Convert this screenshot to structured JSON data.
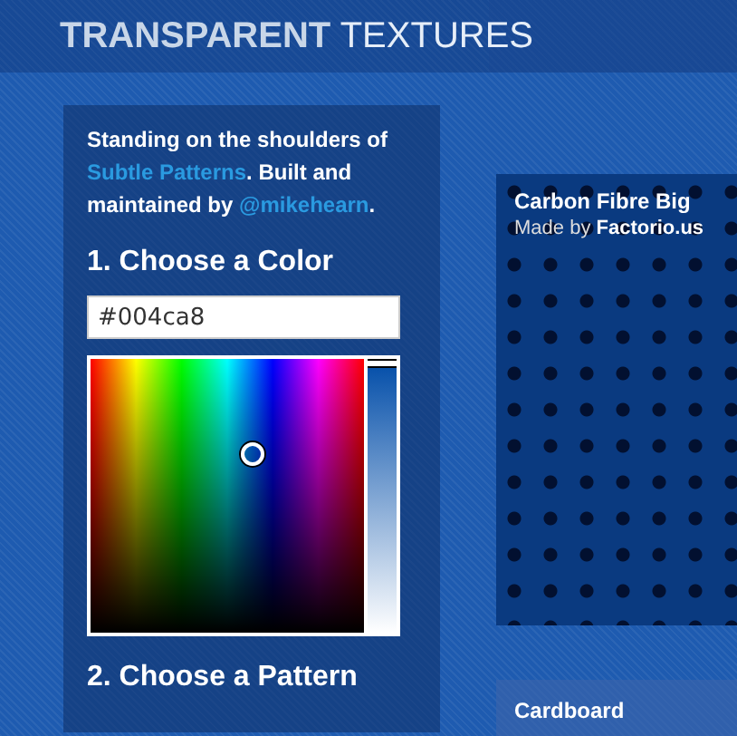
{
  "header": {
    "title_bold": "TRANSPARENT",
    "title_light": "TEXTURES"
  },
  "intro": [
    {
      "text": "Standing on the shoulders of ",
      "kind": "text"
    },
    {
      "text": "Subtle Patterns",
      "kind": "link"
    },
    {
      "text": ". Built and maintained by ",
      "kind": "text"
    },
    {
      "text": "@mikehearn",
      "kind": "link"
    },
    {
      "text": ".",
      "kind": "text"
    }
  ],
  "step1": {
    "heading": "1. Choose a Color",
    "value": "#004ca8",
    "picker": {
      "level": 1
    }
  },
  "step2": {
    "heading": "2. Choose a Pattern"
  },
  "patterns": [
    {
      "name": "Carbon Fibre Big",
      "credit": "Made by **Factorio.us**",
      "kind": "dots"
    },
    {
      "name": "Cardboard",
      "kind": "plain"
    }
  ]
}
